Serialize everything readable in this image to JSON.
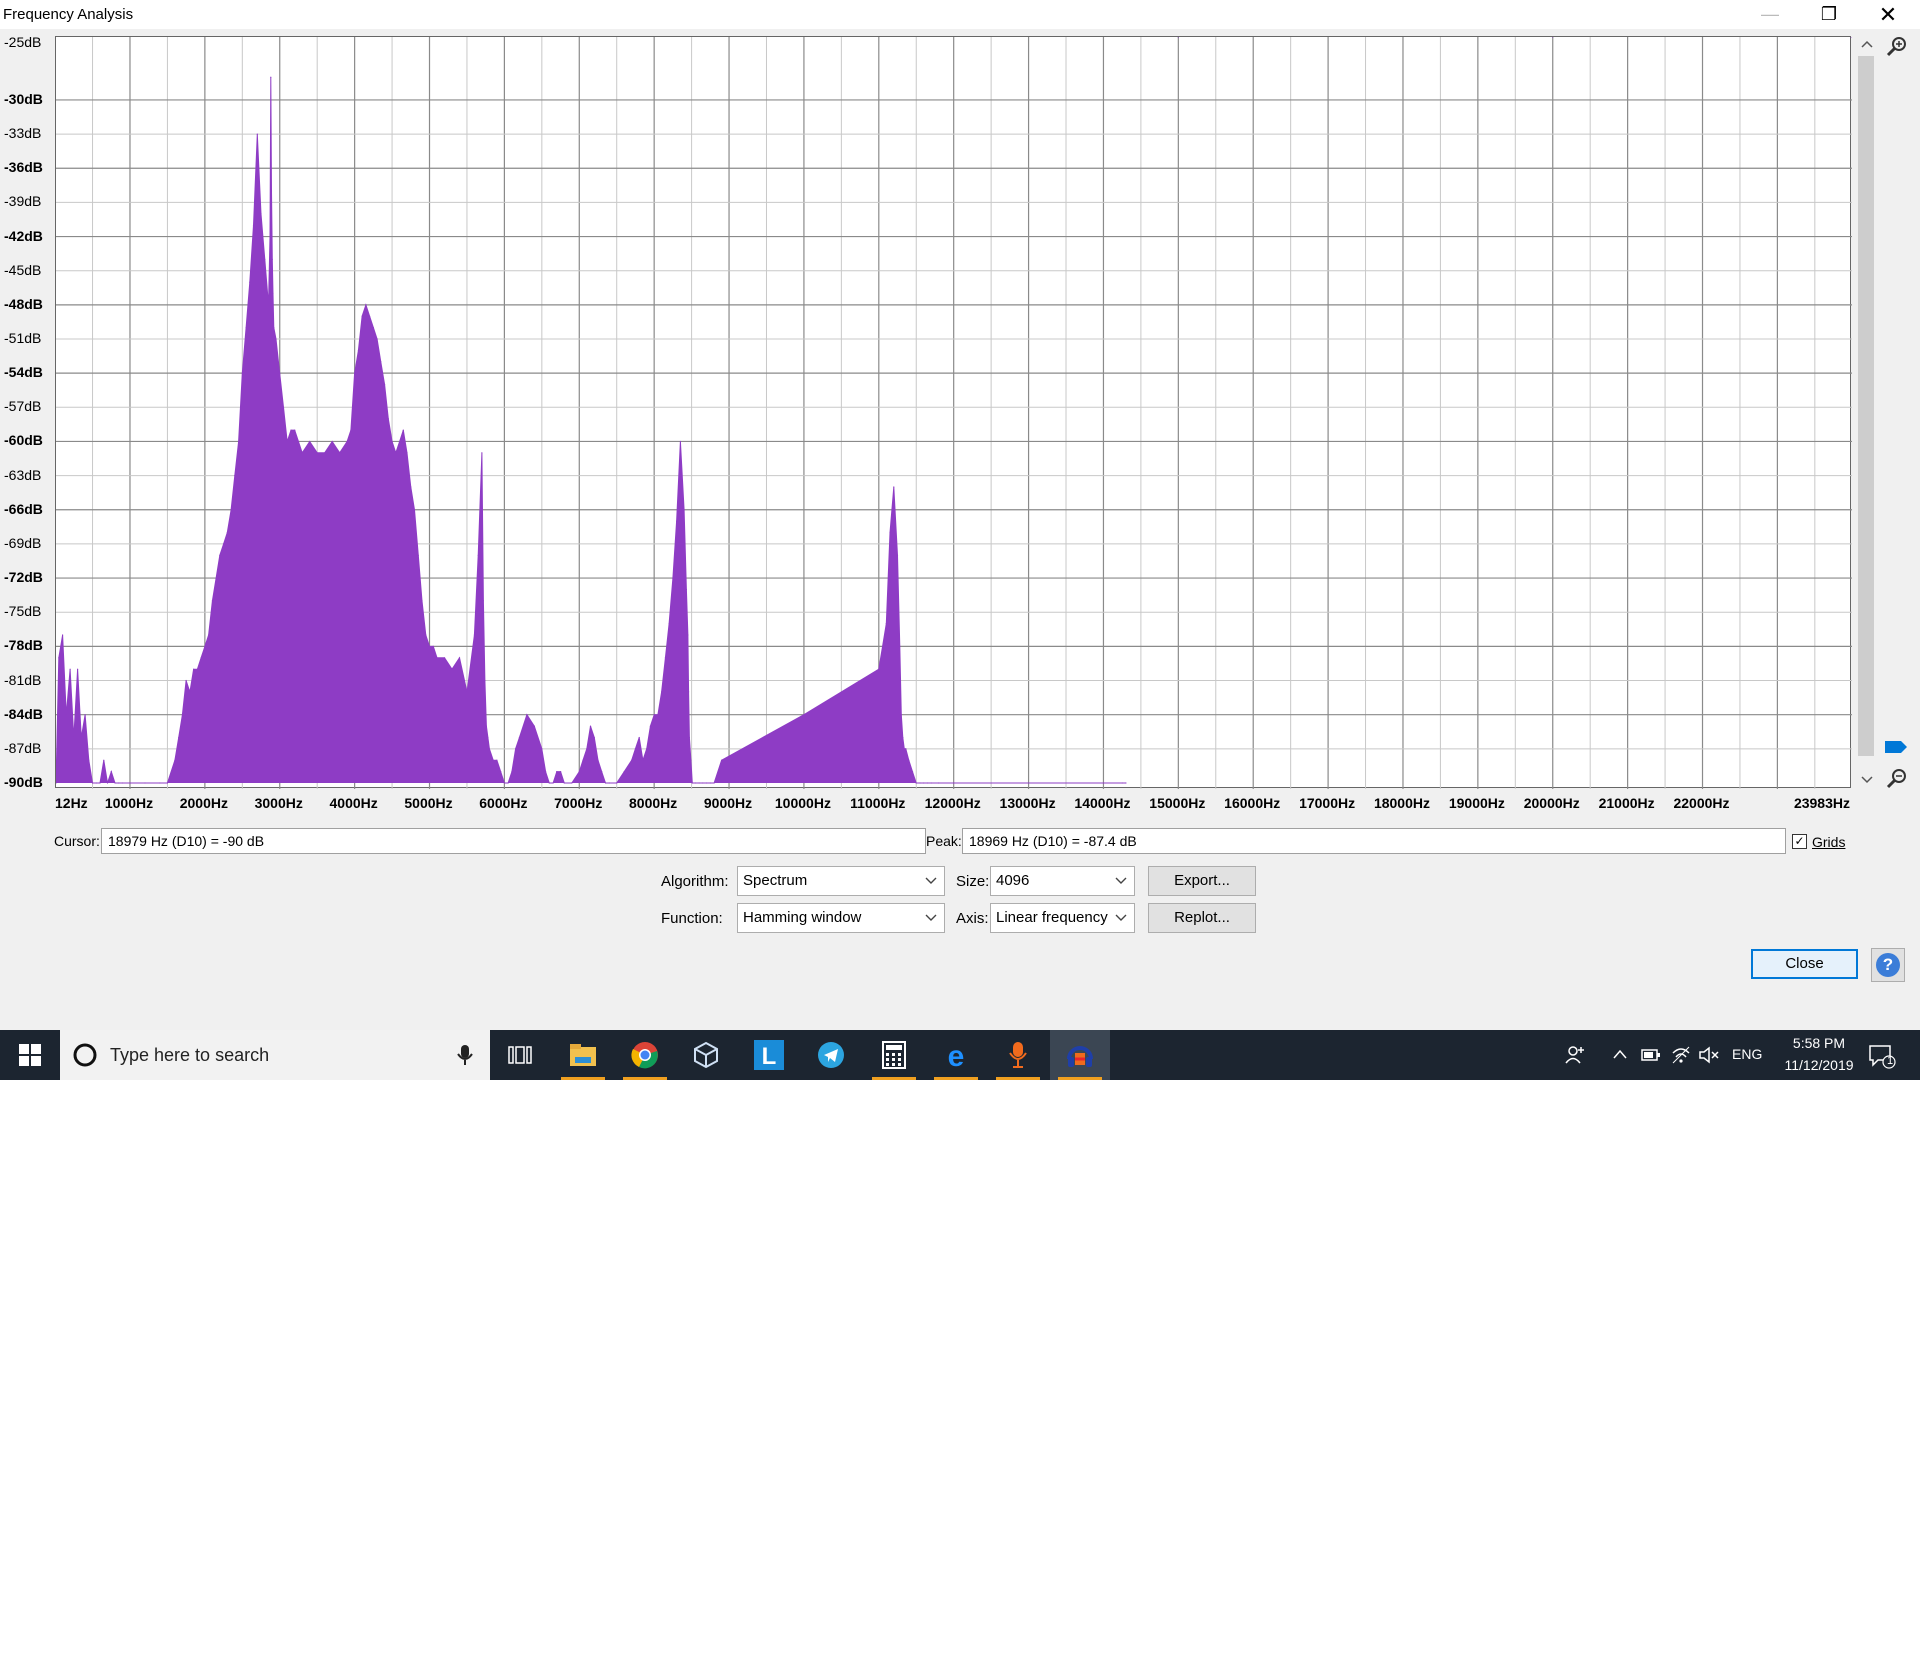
{
  "window": {
    "title": "Frequency Analysis",
    "controls": {
      "minimize": "—",
      "maximize": "❐",
      "close": "✕"
    }
  },
  "chart_data": {
    "type": "area",
    "title": "",
    "xlabel": "",
    "ylabel": "",
    "color": "#8e3cc5",
    "grid": true,
    "y_ticks": [
      "-25dB",
      "-30dB",
      "-33dB",
      "-36dB",
      "-39dB",
      "-42dB",
      "-45dB",
      "-48dB",
      "-51dB",
      "-54dB",
      "-57dB",
      "-60dB",
      "-63dB",
      "-66dB",
      "-69dB",
      "-72dB",
      "-75dB",
      "-78dB",
      "-81dB",
      "-84dB",
      "-87dB",
      "-90dB"
    ],
    "y_tick_values": [
      -25,
      -30,
      -33,
      -36,
      -39,
      -42,
      -45,
      -48,
      -51,
      -54,
      -57,
      -60,
      -63,
      -66,
      -69,
      -72,
      -75,
      -78,
      -81,
      -84,
      -87,
      -90
    ],
    "x_ticks": [
      "12Hz",
      "1000Hz",
      "2000Hz",
      "3000Hz",
      "4000Hz",
      "5000Hz",
      "6000Hz",
      "7000Hz",
      "8000Hz",
      "9000Hz",
      "10000Hz",
      "11000Hz",
      "12000Hz",
      "13000Hz",
      "14000Hz",
      "15000Hz",
      "16000Hz",
      "17000Hz",
      "18000Hz",
      "19000Hz",
      "20000Hz",
      "21000Hz",
      "22000Hz",
      "23983Hz"
    ],
    "x_tick_values": [
      12,
      1000,
      2000,
      3000,
      4000,
      5000,
      6000,
      7000,
      8000,
      9000,
      10000,
      11000,
      12000,
      13000,
      14000,
      15000,
      16000,
      17000,
      18000,
      19000,
      20000,
      21000,
      22000,
      23983
    ],
    "xlim": [
      12,
      23983
    ],
    "ylim": [
      -90,
      -25
    ],
    "x": [
      12,
      50,
      100,
      150,
      200,
      250,
      300,
      350,
      400,
      450,
      500,
      550,
      600,
      650,
      700,
      750,
      800,
      850,
      900,
      1000,
      1200,
      1400,
      1500,
      1600,
      1650,
      1700,
      1750,
      1800,
      1850,
      1900,
      1950,
      2000,
      2050,
      2100,
      2150,
      2200,
      2250,
      2300,
      2350,
      2400,
      2450,
      2500,
      2550,
      2600,
      2650,
      2700,
      2750,
      2800,
      2850,
      2870,
      2880,
      2890,
      2900,
      2910,
      2920,
      2950,
      3000,
      3050,
      3100,
      3150,
      3200,
      3300,
      3400,
      3500,
      3600,
      3700,
      3800,
      3900,
      3950,
      4000,
      4050,
      4100,
      4150,
      4200,
      4250,
      4300,
      4350,
      4400,
      4450,
      4500,
      4550,
      4600,
      4650,
      4700,
      4750,
      4800,
      4850,
      4900,
      4950,
      5000,
      5050,
      5100,
      5200,
      5300,
      5400,
      5500,
      5600,
      5650,
      5700,
      5720,
      5740,
      5760,
      5780,
      5800,
      5850,
      5900,
      5950,
      6000,
      6050,
      6100,
      6150,
      6200,
      6300,
      6400,
      6500,
      6550,
      6600,
      6650,
      6700,
      6750,
      6800,
      6900,
      7000,
      7050,
      7100,
      7150,
      7200,
      7250,
      7300,
      7350,
      7400,
      7500,
      7600,
      7700,
      7750,
      7800,
      7850,
      7900,
      7950,
      8000,
      8050,
      8100,
      8150,
      8200,
      8250,
      8300,
      8350,
      8400,
      8430,
      8450,
      8460,
      8470,
      8490,
      8510,
      8550,
      8600,
      8650,
      8700,
      8750,
      8800,
      8900,
      10000,
      11000,
      11100,
      11150,
      11200,
      11250,
      11280,
      11300,
      11320,
      11340,
      11360,
      11400,
      11450,
      11500,
      11550,
      11600,
      11650,
      11700,
      11800,
      12000,
      14000,
      14250,
      14300,
      15000,
      20000,
      23983
    ],
    "values": [
      -90,
      -79,
      -77,
      -84,
      -80,
      -86,
      -80,
      -86,
      -84,
      -88,
      -90,
      -90,
      -90,
      -88,
      -90,
      -89,
      -90,
      -90,
      -90,
      -90,
      -90,
      -90,
      -90,
      -88,
      -86,
      -84,
      -81,
      -82,
      -80,
      -80,
      -79,
      -78,
      -77,
      -74,
      -72,
      -70,
      -69,
      -68,
      -66,
      -63,
      -60,
      -54,
      -50,
      -46,
      -41,
      -33,
      -40,
      -44,
      -48,
      -42,
      -28,
      -38,
      -44,
      -47,
      -50,
      -51,
      -54,
      -57,
      -60,
      -59,
      -59,
      -61,
      -60,
      -61,
      -61,
      -60,
      -61,
      -60,
      -59,
      -54,
      -52,
      -49,
      -48,
      -49,
      -50,
      -51,
      -53,
      -55,
      -58,
      -60,
      -61,
      -60,
      -59,
      -61,
      -64,
      -66,
      -70,
      -74,
      -77,
      -78,
      -78,
      -79,
      -79,
      -80,
      -79,
      -82,
      -77,
      -70,
      -61,
      -74,
      -81,
      -85,
      -86,
      -87,
      -88,
      -88,
      -89,
      -90,
      -90,
      -89,
      -87,
      -86,
      -84,
      -85,
      -87,
      -89,
      -90,
      -90,
      -89,
      -89,
      -90,
      -90,
      -89,
      -88,
      -87,
      -85,
      -86,
      -88,
      -89,
      -90,
      -90,
      -90,
      -89,
      -88,
      -87,
      -86,
      -88,
      -87,
      -85,
      -84,
      -84,
      -82,
      -79,
      -76,
      -72,
      -67,
      -60,
      -66,
      -73,
      -77,
      -82,
      -86,
      -88,
      -90,
      -90,
      -90,
      -90,
      -90,
      -90,
      -90,
      -88,
      -84,
      -80,
      -76,
      -68,
      -64,
      -70,
      -78,
      -84,
      -86,
      -87,
      -87,
      -88,
      -89,
      -90,
      -90,
      -90,
      -90,
      -90,
      -90,
      -90,
      -90,
      -90,
      -90
    ]
  },
  "info": {
    "cursor_label": "Cursor:",
    "cursor_value": "18979 Hz (D10) = -90 dB",
    "peak_label": "Peak:",
    "peak_value": "18969 Hz (D10) = -87.4 dB",
    "grids_label": "Grids",
    "grids_checked": true,
    "check_mark": "✓"
  },
  "controls": {
    "algorithm_label": "Algorithm:",
    "algorithm_value": "Spectrum",
    "function_label": "Function:",
    "function_value": "Hamming window",
    "size_label": "Size:",
    "size_value": "4096",
    "axis_label": "Axis:",
    "axis_value": "Linear frequency",
    "export_label": "Export...",
    "replot_label": "Replot...",
    "close_label": "Close",
    "help_label": "?"
  },
  "taskbar": {
    "search_placeholder": "Type here to search",
    "language": "ENG",
    "time": "5:58 PM",
    "date": "11/12/2019",
    "notification_count": "1",
    "accent": "#f0a020"
  }
}
